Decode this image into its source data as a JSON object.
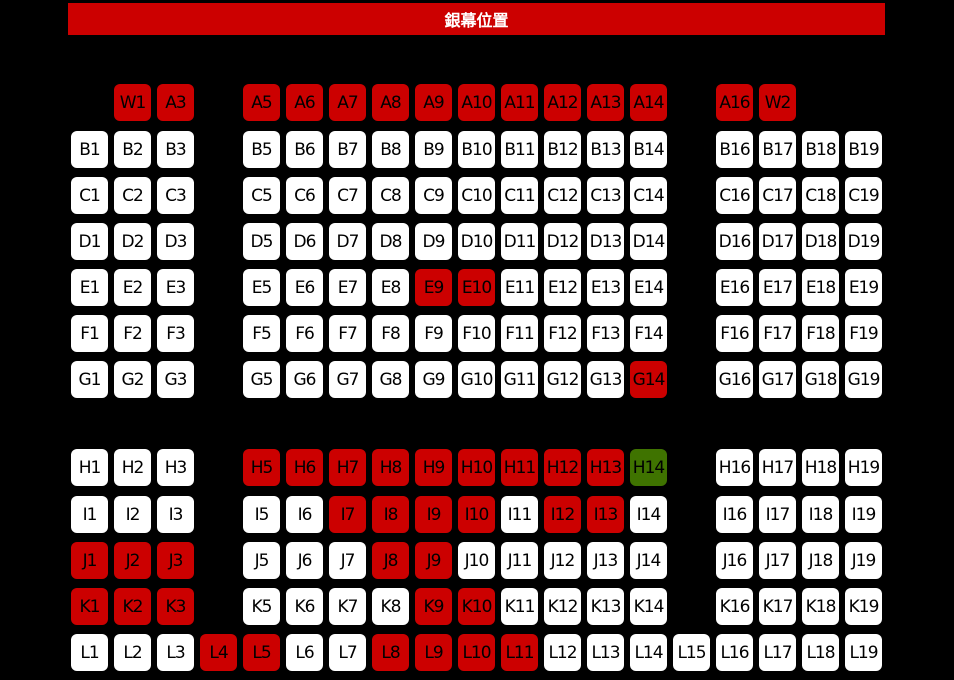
{
  "screen": {
    "label": "銀幕位置"
  },
  "colors": {
    "available": "#ffffff",
    "sold": "#cc0000",
    "selected": "#3f7300",
    "background": "#000000",
    "screen": "#cc0000"
  },
  "rows": [
    {
      "row": "W/A",
      "seats": [
        {
          "label": "W1",
          "status": "sold"
        },
        {
          "label": "A3",
          "status": "sold"
        },
        {
          "label": "A5",
          "status": "sold"
        },
        {
          "label": "A6",
          "status": "sold"
        },
        {
          "label": "A7",
          "status": "sold"
        },
        {
          "label": "A8",
          "status": "sold"
        },
        {
          "label": "A9",
          "status": "sold"
        },
        {
          "label": "A10",
          "status": "sold"
        },
        {
          "label": "A11",
          "status": "sold"
        },
        {
          "label": "A12",
          "status": "sold"
        },
        {
          "label": "A13",
          "status": "sold"
        },
        {
          "label": "A14",
          "status": "sold"
        },
        {
          "label": "A16",
          "status": "sold"
        },
        {
          "label": "W2",
          "status": "sold"
        }
      ]
    },
    {
      "row": "B",
      "seats": [
        {
          "label": "B1",
          "status": "available"
        },
        {
          "label": "B2",
          "status": "available"
        },
        {
          "label": "B3",
          "status": "available"
        },
        {
          "label": "B5",
          "status": "available"
        },
        {
          "label": "B6",
          "status": "available"
        },
        {
          "label": "B7",
          "status": "available"
        },
        {
          "label": "B8",
          "status": "available"
        },
        {
          "label": "B9",
          "status": "available"
        },
        {
          "label": "B10",
          "status": "available"
        },
        {
          "label": "B11",
          "status": "available"
        },
        {
          "label": "B12",
          "status": "available"
        },
        {
          "label": "B13",
          "status": "available"
        },
        {
          "label": "B14",
          "status": "available"
        },
        {
          "label": "B16",
          "status": "available"
        },
        {
          "label": "B17",
          "status": "available"
        },
        {
          "label": "B18",
          "status": "available"
        },
        {
          "label": "B19",
          "status": "available"
        }
      ]
    },
    {
      "row": "C",
      "seats": [
        {
          "label": "C1",
          "status": "available"
        },
        {
          "label": "C2",
          "status": "available"
        },
        {
          "label": "C3",
          "status": "available"
        },
        {
          "label": "C5",
          "status": "available"
        },
        {
          "label": "C6",
          "status": "available"
        },
        {
          "label": "C7",
          "status": "available"
        },
        {
          "label": "C8",
          "status": "available"
        },
        {
          "label": "C9",
          "status": "available"
        },
        {
          "label": "C10",
          "status": "available"
        },
        {
          "label": "C11",
          "status": "available"
        },
        {
          "label": "C12",
          "status": "available"
        },
        {
          "label": "C13",
          "status": "available"
        },
        {
          "label": "C14",
          "status": "available"
        },
        {
          "label": "C16",
          "status": "available"
        },
        {
          "label": "C17",
          "status": "available"
        },
        {
          "label": "C18",
          "status": "available"
        },
        {
          "label": "C19",
          "status": "available"
        }
      ]
    },
    {
      "row": "D",
      "seats": [
        {
          "label": "D1",
          "status": "available"
        },
        {
          "label": "D2",
          "status": "available"
        },
        {
          "label": "D3",
          "status": "available"
        },
        {
          "label": "D5",
          "status": "available"
        },
        {
          "label": "D6",
          "status": "available"
        },
        {
          "label": "D7",
          "status": "available"
        },
        {
          "label": "D8",
          "status": "available"
        },
        {
          "label": "D9",
          "status": "available"
        },
        {
          "label": "D10",
          "status": "available"
        },
        {
          "label": "D11",
          "status": "available"
        },
        {
          "label": "D12",
          "status": "available"
        },
        {
          "label": "D13",
          "status": "available"
        },
        {
          "label": "D14",
          "status": "available"
        },
        {
          "label": "D16",
          "status": "available"
        },
        {
          "label": "D17",
          "status": "available"
        },
        {
          "label": "D18",
          "status": "available"
        },
        {
          "label": "D19",
          "status": "available"
        }
      ]
    },
    {
      "row": "E",
      "seats": [
        {
          "label": "E1",
          "status": "available"
        },
        {
          "label": "E2",
          "status": "available"
        },
        {
          "label": "E3",
          "status": "available"
        },
        {
          "label": "E5",
          "status": "available"
        },
        {
          "label": "E6",
          "status": "available"
        },
        {
          "label": "E7",
          "status": "available"
        },
        {
          "label": "E8",
          "status": "available"
        },
        {
          "label": "E9",
          "status": "sold"
        },
        {
          "label": "E10",
          "status": "sold"
        },
        {
          "label": "E11",
          "status": "available"
        },
        {
          "label": "E12",
          "status": "available"
        },
        {
          "label": "E13",
          "status": "available"
        },
        {
          "label": "E14",
          "status": "available"
        },
        {
          "label": "E16",
          "status": "available"
        },
        {
          "label": "E17",
          "status": "available"
        },
        {
          "label": "E18",
          "status": "available"
        },
        {
          "label": "E19",
          "status": "available"
        }
      ]
    },
    {
      "row": "F",
      "seats": [
        {
          "label": "F1",
          "status": "available"
        },
        {
          "label": "F2",
          "status": "available"
        },
        {
          "label": "F3",
          "status": "available"
        },
        {
          "label": "F5",
          "status": "available"
        },
        {
          "label": "F6",
          "status": "available"
        },
        {
          "label": "F7",
          "status": "available"
        },
        {
          "label": "F8",
          "status": "available"
        },
        {
          "label": "F9",
          "status": "available"
        },
        {
          "label": "F10",
          "status": "available"
        },
        {
          "label": "F11",
          "status": "available"
        },
        {
          "label": "F12",
          "status": "available"
        },
        {
          "label": "F13",
          "status": "available"
        },
        {
          "label": "F14",
          "status": "available"
        },
        {
          "label": "F16",
          "status": "available"
        },
        {
          "label": "F17",
          "status": "available"
        },
        {
          "label": "F18",
          "status": "available"
        },
        {
          "label": "F19",
          "status": "available"
        }
      ]
    },
    {
      "row": "G",
      "seats": [
        {
          "label": "G1",
          "status": "available"
        },
        {
          "label": "G2",
          "status": "available"
        },
        {
          "label": "G3",
          "status": "available"
        },
        {
          "label": "G5",
          "status": "available"
        },
        {
          "label": "G6",
          "status": "available"
        },
        {
          "label": "G7",
          "status": "available"
        },
        {
          "label": "G8",
          "status": "available"
        },
        {
          "label": "G9",
          "status": "available"
        },
        {
          "label": "G10",
          "status": "available"
        },
        {
          "label": "G11",
          "status": "available"
        },
        {
          "label": "G12",
          "status": "available"
        },
        {
          "label": "G13",
          "status": "available"
        },
        {
          "label": "G14",
          "status": "sold"
        },
        {
          "label": "G16",
          "status": "available"
        },
        {
          "label": "G17",
          "status": "available"
        },
        {
          "label": "G18",
          "status": "available"
        },
        {
          "label": "G19",
          "status": "available"
        }
      ]
    },
    {
      "row": "H",
      "seats": [
        {
          "label": "H1",
          "status": "available"
        },
        {
          "label": "H2",
          "status": "available"
        },
        {
          "label": "H3",
          "status": "available"
        },
        {
          "label": "H5",
          "status": "sold"
        },
        {
          "label": "H6",
          "status": "sold"
        },
        {
          "label": "H7",
          "status": "sold"
        },
        {
          "label": "H8",
          "status": "sold"
        },
        {
          "label": "H9",
          "status": "sold"
        },
        {
          "label": "H10",
          "status": "sold"
        },
        {
          "label": "H11",
          "status": "sold"
        },
        {
          "label": "H12",
          "status": "sold"
        },
        {
          "label": "H13",
          "status": "sold"
        },
        {
          "label": "H14",
          "status": "selected"
        },
        {
          "label": "H16",
          "status": "available"
        },
        {
          "label": "H17",
          "status": "available"
        },
        {
          "label": "H18",
          "status": "available"
        },
        {
          "label": "H19",
          "status": "available"
        }
      ]
    },
    {
      "row": "I",
      "seats": [
        {
          "label": "I1",
          "status": "available"
        },
        {
          "label": "I2",
          "status": "available"
        },
        {
          "label": "I3",
          "status": "available"
        },
        {
          "label": "I5",
          "status": "available"
        },
        {
          "label": "I6",
          "status": "available"
        },
        {
          "label": "I7",
          "status": "sold"
        },
        {
          "label": "I8",
          "status": "sold"
        },
        {
          "label": "I9",
          "status": "sold"
        },
        {
          "label": "I10",
          "status": "sold"
        },
        {
          "label": "I11",
          "status": "available"
        },
        {
          "label": "I12",
          "status": "sold"
        },
        {
          "label": "I13",
          "status": "sold"
        },
        {
          "label": "I14",
          "status": "available"
        },
        {
          "label": "I16",
          "status": "available"
        },
        {
          "label": "I17",
          "status": "available"
        },
        {
          "label": "I18",
          "status": "available"
        },
        {
          "label": "I19",
          "status": "available"
        }
      ]
    },
    {
      "row": "J",
      "seats": [
        {
          "label": "J1",
          "status": "sold"
        },
        {
          "label": "J2",
          "status": "sold"
        },
        {
          "label": "J3",
          "status": "sold"
        },
        {
          "label": "J5",
          "status": "available"
        },
        {
          "label": "J6",
          "status": "available"
        },
        {
          "label": "J7",
          "status": "available"
        },
        {
          "label": "J8",
          "status": "sold"
        },
        {
          "label": "J9",
          "status": "sold"
        },
        {
          "label": "J10",
          "status": "available"
        },
        {
          "label": "J11",
          "status": "available"
        },
        {
          "label": "J12",
          "status": "available"
        },
        {
          "label": "J13",
          "status": "available"
        },
        {
          "label": "J14",
          "status": "available"
        },
        {
          "label": "J16",
          "status": "available"
        },
        {
          "label": "J17",
          "status": "available"
        },
        {
          "label": "J18",
          "status": "available"
        },
        {
          "label": "J19",
          "status": "available"
        }
      ]
    },
    {
      "row": "K",
      "seats": [
        {
          "label": "K1",
          "status": "sold"
        },
        {
          "label": "K2",
          "status": "sold"
        },
        {
          "label": "K3",
          "status": "sold"
        },
        {
          "label": "K5",
          "status": "available"
        },
        {
          "label": "K6",
          "status": "available"
        },
        {
          "label": "K7",
          "status": "available"
        },
        {
          "label": "K8",
          "status": "available"
        },
        {
          "label": "K9",
          "status": "sold"
        },
        {
          "label": "K10",
          "status": "sold"
        },
        {
          "label": "K11",
          "status": "available"
        },
        {
          "label": "K12",
          "status": "available"
        },
        {
          "label": "K13",
          "status": "available"
        },
        {
          "label": "K14",
          "status": "available"
        },
        {
          "label": "K16",
          "status": "available"
        },
        {
          "label": "K17",
          "status": "available"
        },
        {
          "label": "K18",
          "status": "available"
        },
        {
          "label": "K19",
          "status": "available"
        }
      ]
    },
    {
      "row": "L",
      "seats": [
        {
          "label": "L1",
          "status": "available"
        },
        {
          "label": "L2",
          "status": "available"
        },
        {
          "label": "L3",
          "status": "available"
        },
        {
          "label": "L4",
          "status": "sold"
        },
        {
          "label": "L5",
          "status": "sold"
        },
        {
          "label": "L6",
          "status": "available"
        },
        {
          "label": "L7",
          "status": "available"
        },
        {
          "label": "L8",
          "status": "sold"
        },
        {
          "label": "L9",
          "status": "sold"
        },
        {
          "label": "L10",
          "status": "sold"
        },
        {
          "label": "L11",
          "status": "sold"
        },
        {
          "label": "L12",
          "status": "available"
        },
        {
          "label": "L13",
          "status": "available"
        },
        {
          "label": "L14",
          "status": "available"
        },
        {
          "label": "L15",
          "status": "available"
        },
        {
          "label": "L16",
          "status": "available"
        },
        {
          "label": "L17",
          "status": "available"
        },
        {
          "label": "L18",
          "status": "available"
        },
        {
          "label": "L19",
          "status": "available"
        }
      ]
    }
  ]
}
